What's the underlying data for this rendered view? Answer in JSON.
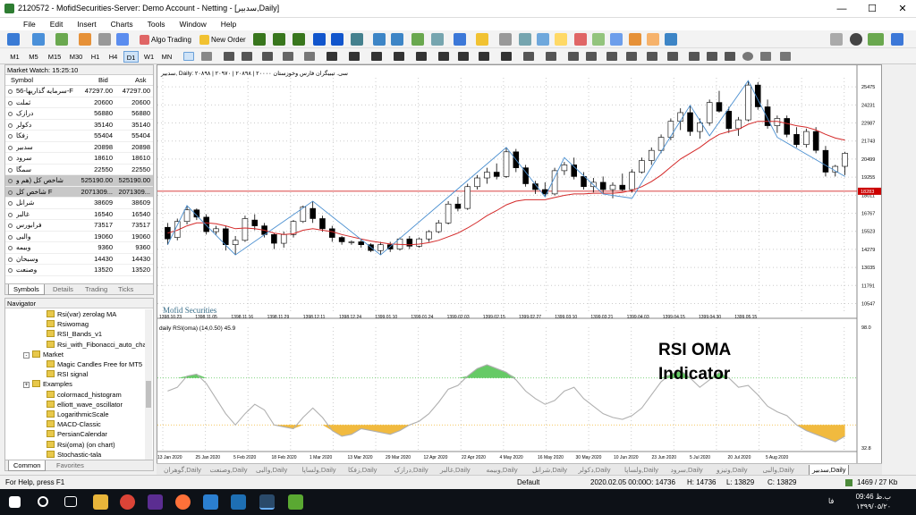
{
  "window": {
    "title": "2120572 - MofidSecurities-Server: Demo Account - Netting - [سدبیر,Daily]"
  },
  "menu": [
    "File",
    "Edit",
    "Insert",
    "Charts",
    "Tools",
    "Window",
    "Help"
  ],
  "toolbar": {
    "algo_trading": "Algo Trading",
    "new_order": "New Order"
  },
  "timeframes": [
    "M1",
    "M5",
    "M15",
    "M30",
    "H1",
    "H4",
    "D1",
    "W1",
    "MN"
  ],
  "selected_timeframe": "D1",
  "market_watch": {
    "header": "Market Watch: 15:25:10",
    "columns": {
      "symbol": "Symbol",
      "bid": "Bid",
      "ask": "Ask"
    },
    "rows": [
      {
        "symbol": "سرمایه گذاریها-56-F",
        "bid": "47297.00",
        "ask": "47297.00"
      },
      {
        "symbol": "ثملت",
        "bid": "20600",
        "ask": "20600"
      },
      {
        "symbol": "درازک",
        "bid": "56880",
        "ask": "56880"
      },
      {
        "symbol": "دکولر",
        "bid": "35140",
        "ask": "35140"
      },
      {
        "symbol": "زفکا",
        "bid": "55404",
        "ask": "55404"
      },
      {
        "symbol": "سدبیر",
        "bid": "20898",
        "ask": "20898"
      },
      {
        "symbol": "سرود",
        "bid": "18610",
        "ask": "18610"
      },
      {
        "symbol": "سمگا",
        "bid": "22550",
        "ask": "22550"
      },
      {
        "symbol": "شاخص کل (هم و",
        "bid": "525190.00",
        "ask": "525190.00"
      },
      {
        "symbol": "شاخص کل F",
        "bid": "2071309...",
        "ask": "2071309..."
      },
      {
        "symbol": "شرانل",
        "bid": "38609",
        "ask": "38609"
      },
      {
        "symbol": "غالبر",
        "bid": "16540",
        "ask": "16540"
      },
      {
        "symbol": "فرابورس",
        "bid": "73517",
        "ask": "73517"
      },
      {
        "symbol": "والبی",
        "bid": "19060",
        "ask": "19060"
      },
      {
        "symbol": "وبیمه",
        "bid": "9360",
        "ask": "9360"
      },
      {
        "symbol": "وسبحان",
        "bid": "14430",
        "ask": "14430"
      },
      {
        "symbol": "وصنعت",
        "bid": "13520",
        "ask": "13520"
      }
    ],
    "tabs": [
      "Symbols",
      "Details",
      "Trading",
      "Ticks"
    ]
  },
  "navigator": {
    "header": "Navigator",
    "items": [
      {
        "label": "Rsi(var) zerolag MA",
        "type": "item"
      },
      {
        "label": "Rsiwomag",
        "type": "item"
      },
      {
        "label": "RSI_Bands_v1",
        "type": "item"
      },
      {
        "label": "Rsi_with_Fibonacci_auto_cha",
        "type": "item"
      },
      {
        "label": "Market",
        "type": "folder",
        "toggle": "-"
      },
      {
        "label": "Magic Candles Free for MT5",
        "type": "item"
      },
      {
        "label": "RSI signal",
        "type": "item"
      },
      {
        "label": "Examples",
        "type": "folder",
        "toggle": "+"
      },
      {
        "label": "colormacd_histogram",
        "type": "item"
      },
      {
        "label": "elliott_wave_oscillator",
        "type": "item"
      },
      {
        "label": "LogarithmicScale",
        "type": "item"
      },
      {
        "label": "MACD-Classic",
        "type": "item"
      },
      {
        "label": "PersianCalendar",
        "type": "item"
      },
      {
        "label": "Rsi(oma) (on chart)",
        "type": "item"
      },
      {
        "label": "Stochastic-tala",
        "type": "item"
      }
    ],
    "tabs": [
      "Common",
      "Favorites"
    ]
  },
  "chart": {
    "header": "سدبیر, Daily: ۲۰۸۹۸ | ۲۰۹۷۰ | ۲۰۸۹۸ | ۲۰۰۰۰ سی. تیبیگران فارس وخوزستان",
    "watermark": "Mofid Securities",
    "indicator_label": "daily RSI(oma) (14,0.50) 45.9",
    "overlay_title_1": "RSI OMA",
    "overlay_title_2": "Indicator",
    "price_axis": [
      "25475",
      "24231",
      "22987",
      "21743",
      "20499",
      "19255",
      "18011",
      "16767",
      "15523",
      "14279",
      "13035",
      "11791",
      "10547"
    ],
    "current_price": "18283",
    "rsi_axis_top": "98.0",
    "rsi_axis_bottom": "32.8",
    "jalali_dates": [
      "1398.10.23",
      "1398.11.05",
      "1398.11.16",
      "1398.11.29",
      "1398.12.11",
      "1398.12.24",
      "1399.01.10",
      "1399.01.24",
      "1399.02.03",
      "1399.02.15",
      "1399.02.27",
      "1399.03.10",
      "1399.03.21",
      "1399.04.03",
      "1399.04.15",
      "1399.04.30",
      "1399.05.15"
    ],
    "gregorian_dates": [
      "13 Jan 2020",
      "25 Jan 2020",
      "5 Feb 2020",
      "18 Feb 2020",
      "1 Mar 2020",
      "13 Mar 2020",
      "29 Mar 2020",
      "12 Apr 2020",
      "22 Apr 2020",
      "4 May 2020",
      "16 May 2020",
      "30 May 2020",
      "10 Jun 2020",
      "23 Jun 2020",
      "5 Jul 2020",
      "20 Jul 2020",
      "5 Aug 2020"
    ],
    "colors": {
      "bull": "#ffffff",
      "bear": "#000000",
      "ma": "#d42a2a",
      "zigzag": "#4a8fd0",
      "rsi_line": "#b0b0b0",
      "rsi_up": "#55c455",
      "rsi_down": "#f0b32a",
      "hline": "#cc0000"
    }
  },
  "chart_data": {
    "type": "candlestick",
    "candles": [
      [
        15800,
        16100,
        14600,
        15000
      ],
      [
        15100,
        16400,
        14900,
        16200
      ],
      [
        16200,
        17300,
        16000,
        17000
      ],
      [
        17000,
        17100,
        16300,
        16500
      ],
      [
        16500,
        16700,
        15300,
        15500
      ],
      [
        15500,
        15900,
        15300,
        15700
      ],
      [
        15700,
        15900,
        14200,
        14600
      ],
      [
        14600,
        15200,
        13900,
        14900
      ],
      [
        14900,
        16600,
        14800,
        16400
      ],
      [
        16300,
        16700,
        15600,
        15900
      ],
      [
        15900,
        16100,
        15100,
        15300
      ],
      [
        15300,
        15400,
        14300,
        14700
      ],
      [
        14700,
        15500,
        14400,
        15300
      ],
      [
        15300,
        16300,
        15100,
        16200
      ],
      [
        16200,
        17300,
        16100,
        17200
      ],
      [
        17100,
        17600,
        16100,
        16400
      ],
      [
        16400,
        16600,
        15500,
        15700
      ],
      [
        15700,
        15900,
        14800,
        15100
      ],
      [
        15100,
        15200,
        14600,
        14800
      ],
      [
        14800,
        14900,
        14600,
        14800
      ],
      [
        14800,
        15000,
        14400,
        14600
      ],
      [
        14600,
        14700,
        14100,
        14200
      ],
      [
        14200,
        14800,
        13900,
        14600
      ],
      [
        14600,
        14800,
        14100,
        14300
      ],
      [
        14300,
        15100,
        14200,
        15000
      ],
      [
        15000,
        15200,
        14300,
        14500
      ],
      [
        14500,
        15100,
        14400,
        15000
      ],
      [
        15000,
        15600,
        14800,
        15500
      ],
      [
        15500,
        16300,
        15400,
        16100
      ],
      [
        16100,
        17600,
        16000,
        17400
      ],
      [
        17400,
        17900,
        16900,
        17100
      ],
      [
        17100,
        18800,
        17000,
        18600
      ],
      [
        18600,
        19400,
        18400,
        19200
      ],
      [
        19200,
        19900,
        18800,
        19600
      ],
      [
        19600,
        20200,
        19100,
        19300
      ],
      [
        19300,
        21300,
        19200,
        21000
      ],
      [
        21000,
        21200,
        19600,
        19900
      ],
      [
        19900,
        20100,
        18600,
        18800
      ],
      [
        18800,
        19000,
        18100,
        18400
      ],
      [
        18400,
        18900,
        17900,
        18100
      ],
      [
        18100,
        19900,
        18000,
        19700
      ],
      [
        19700,
        20300,
        19400,
        20100
      ],
      [
        20100,
        20600,
        19100,
        19300
      ],
      [
        19300,
        19600,
        18400,
        18600
      ],
      [
        18600,
        19200,
        18200,
        18900
      ],
      [
        18900,
        19300,
        18100,
        18400
      ],
      [
        18400,
        18900,
        17800,
        18700
      ],
      [
        18700,
        19500,
        18300,
        18400
      ],
      [
        18400,
        19800,
        18200,
        19600
      ],
      [
        19600,
        20600,
        19500,
        20400
      ],
      [
        20400,
        21300,
        20100,
        21100
      ],
      [
        21100,
        22200,
        20900,
        22000
      ],
      [
        22000,
        23300,
        21800,
        23100
      ],
      [
        23100,
        24000,
        22500,
        23700
      ],
      [
        23700,
        24200,
        22100,
        22400
      ],
      [
        22400,
        23300,
        21900,
        23000
      ],
      [
        23000,
        24600,
        22800,
        24400
      ],
      [
        24400,
        25200,
        23700,
        23800
      ],
      [
        23800,
        24100,
        22300,
        22600
      ],
      [
        22600,
        23400,
        22100,
        23200
      ],
      [
        23200,
        25900,
        23100,
        25600
      ],
      [
        25600,
        25800,
        23900,
        24100
      ],
      [
        24100,
        24600,
        22600,
        22800
      ],
      [
        22800,
        23500,
        22300,
        23300
      ],
      [
        23300,
        23500,
        22000,
        22200
      ],
      [
        22200,
        22700,
        21300,
        21500
      ],
      [
        21500,
        22600,
        21300,
        22400
      ],
      [
        22400,
        22700,
        20900,
        21100
      ],
      [
        21100,
        21400,
        19300,
        19600
      ],
      [
        19600,
        20100,
        19300,
        20000
      ],
      [
        20000,
        21000,
        19400,
        20900
      ]
    ],
    "ma": [
      15400,
      15600,
      15900,
      16100,
      16100,
      16050,
      15900,
      15700,
      15750,
      15700,
      15600,
      15400,
      15300,
      15350,
      15600,
      15700,
      15600,
      15500,
      15300,
      15150,
      15000,
      14850,
      14750,
      14650,
      14620,
      14600,
      14640,
      14740,
      14900,
      15150,
      15400,
      15750,
      16150,
      16600,
      16950,
      17350,
      17600,
      17700,
      17700,
      17700,
      17850,
      18000,
      18100,
      18100,
      18150,
      18150,
      18150,
      18200,
      18350,
      18600,
      18950,
      19400,
      19950,
      20500,
      20900,
      21300,
      21800,
      22200,
      22400,
      22550,
      22900,
      23100,
      23100,
      23100,
      22950,
      22800,
      22700,
      22500,
      22200,
      21950,
      21800
    ],
    "zigzag": [
      [
        0,
        14600
      ],
      [
        2,
        17300
      ],
      [
        7,
        13900
      ],
      [
        15,
        17600
      ],
      [
        22,
        13900
      ],
      [
        35,
        21300
      ],
      [
        39,
        17900
      ],
      [
        41,
        20600
      ],
      [
        45,
        18100
      ],
      [
        48,
        17800
      ],
      [
        54,
        24200
      ],
      [
        56,
        22100
      ],
      [
        60,
        25900
      ],
      [
        63,
        22000
      ],
      [
        70,
        19300
      ]
    ],
    "rsi": [
      64,
      66,
      72,
      73,
      68,
      60,
      52,
      46,
      52,
      57,
      54,
      46,
      45,
      44,
      50,
      55,
      50,
      43,
      40,
      41,
      44,
      43,
      42,
      41,
      43,
      46,
      48,
      52,
      58,
      65,
      67,
      72,
      76,
      78,
      76,
      74,
      70,
      64,
      60,
      57,
      59,
      64,
      66,
      60,
      56,
      52,
      50,
      49,
      51,
      55,
      62,
      69,
      73,
      75,
      71,
      66,
      70,
      74,
      71,
      66,
      67,
      62,
      56,
      53,
      51,
      46,
      43,
      41,
      39,
      37,
      40
    ],
    "rsi_upper": 71,
    "rsi_lower": 46,
    "price_ylim": [
      9900,
      26100
    ],
    "rsi_ylim": [
      32.8,
      98.0
    ]
  },
  "symbol_tabs": [
    "گوهران,Daily",
    "وصنعت,Daily",
    "والبی,Daily",
    "ولساپا,Daily",
    "زفکا,Daily",
    "درازک,Daily",
    "غالبر,Daily",
    "وبیمه,Daily",
    "شرانل,Daily",
    "دکولر,Daily",
    "ولساپا,Daily",
    "سرود,Daily",
    "وتیزو,Daily",
    "والبی,Daily",
    "سدبیر,Daily"
  ],
  "active_symbol_tab": "سدبیر,Daily",
  "status": {
    "help": "For Help, press F1",
    "profile": "Default",
    "datetime": "2020.02.05 00:00",
    "open": "O: 14736",
    "high": "H: 14736",
    "low": "L: 13829",
    "close": "C: 13829",
    "traffic": "1469 / 27 Kb"
  },
  "taskbar": {
    "time": "09:46 ب.ظ",
    "date": "۱۳۹۹/۰۵/۲۰",
    "lang": "فا"
  }
}
